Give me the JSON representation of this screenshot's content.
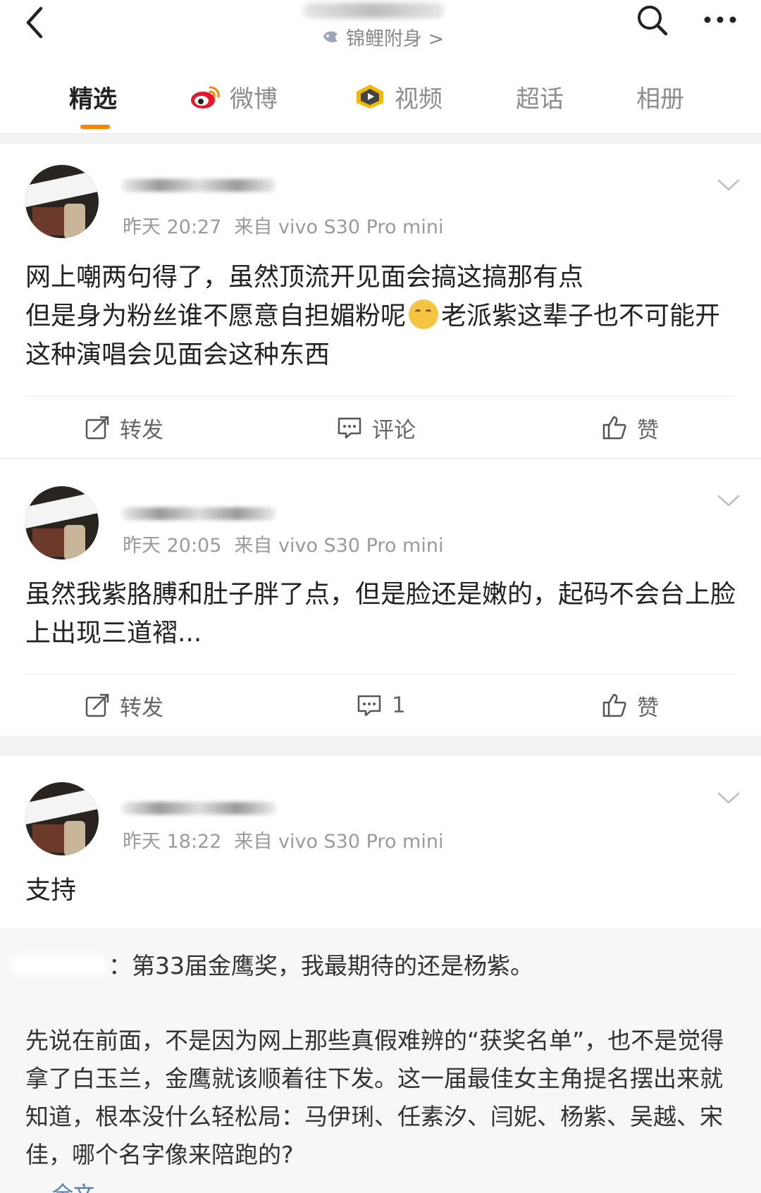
{
  "header": {
    "subtitle": "锦鲤附身 >"
  },
  "tabs": [
    {
      "label": "精选",
      "active": true
    },
    {
      "label": "微博",
      "icon": "weibo-icon"
    },
    {
      "label": "视频",
      "icon": "video-icon"
    },
    {
      "label": "超话"
    },
    {
      "label": "相册"
    }
  ],
  "comments": [
    {
      "time": "昨天 20:27",
      "source": "来自 vivo S30 Pro mini",
      "text_before_emoji": "网上嘲两句得了，虽然顶流开见面会搞这搞那有点",
      "text_after_emoji": "老派紫这辈子也不可能开这种演唱会见面会这种东西",
      "text_mid": "但是身为粉丝谁不愿意自担媚粉呢",
      "repost": "转发",
      "comment": "评论",
      "like": "赞"
    },
    {
      "time": "昨天 20:05",
      "source": "来自 vivo S30 Pro mini",
      "text": "虽然我紫胳膊和肚子胖了点，但是脸还是嫩的，起码不会台上脸上出现三道褶...",
      "repost": "转发",
      "comment": "1",
      "like": "赞"
    },
    {
      "time": "昨天 18:22",
      "source": "来自 vivo S30 Pro mini",
      "text": "支持"
    }
  ],
  "quote": {
    "title": "：第33届金鹰奖，我最期待的还是杨紫。",
    "text": "先说在前面，不是因为网上那些真假难辨的“获奖名单”，也不是觉得拿了白玉兰，金鹰就该顺着往下发。这一届最佳女主角提名摆出来就知道，根本没什么轻松局：马伊琍、任素汐、闫妮、杨紫、吴越、宋佳，哪个名字像来陪跑的?",
    "more": "全文"
  },
  "colors": {
    "accent": "#ff8200",
    "link": "#507daf",
    "muted": "#9a9a9a"
  }
}
